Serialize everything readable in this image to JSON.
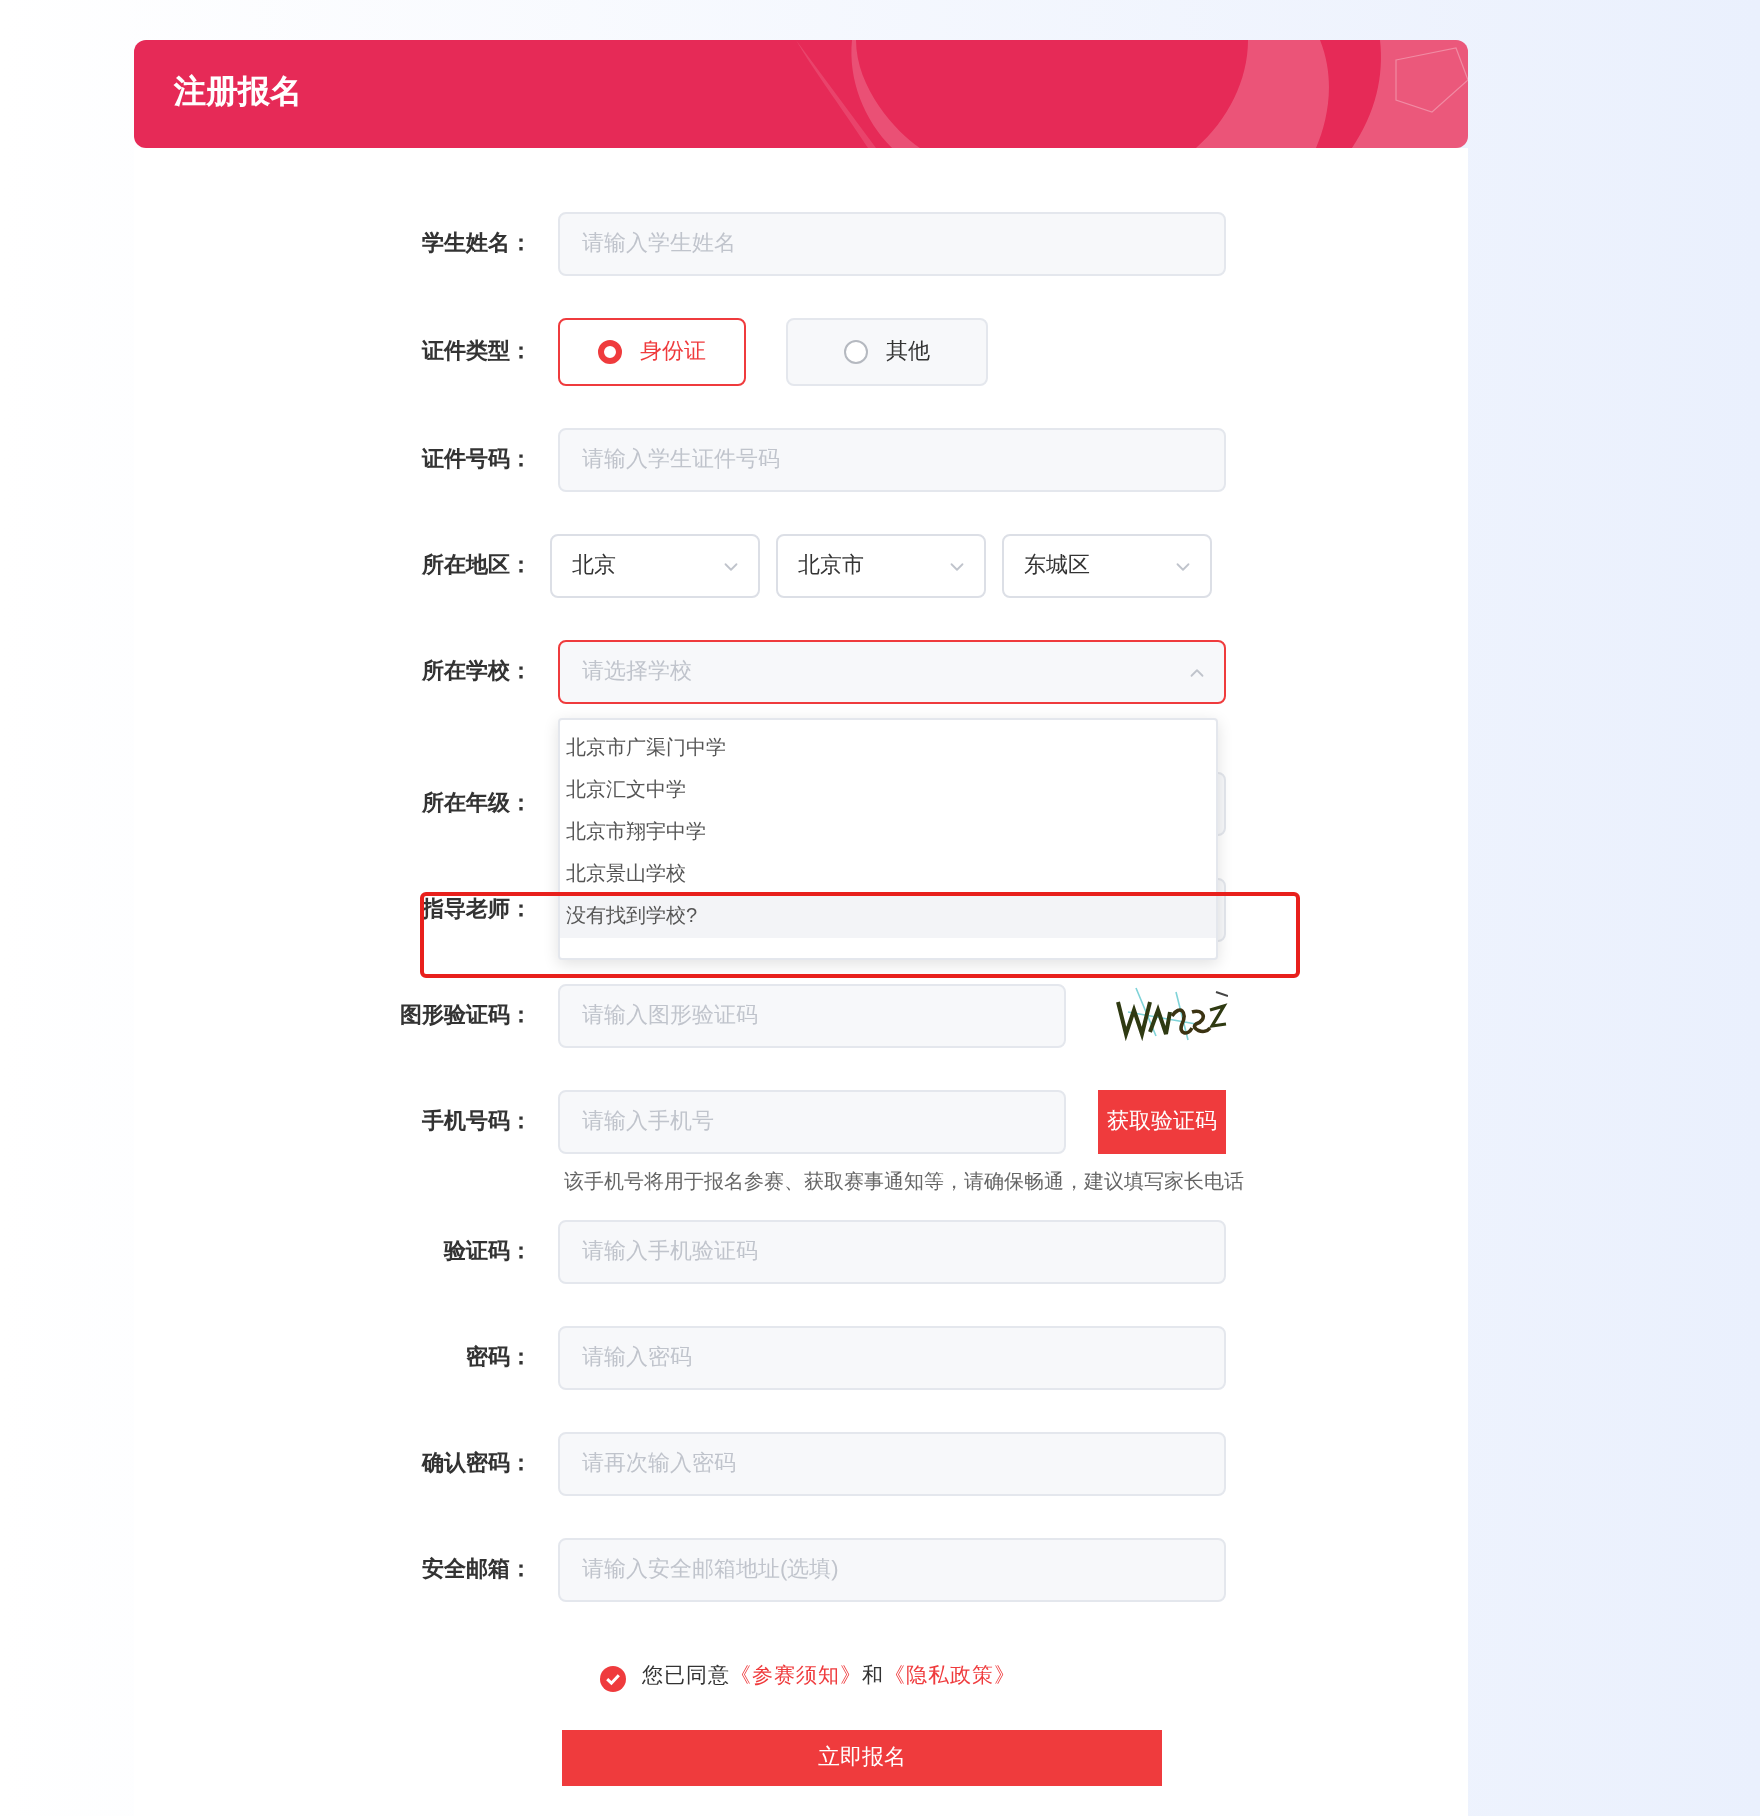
{
  "header": {
    "title": "注册报名"
  },
  "form": {
    "rows": [
      {
        "kind": "input",
        "label": "学生姓名：",
        "placeholder": "请输入学生姓名"
      },
      {
        "kind": "radio",
        "label": "证件类型：",
        "options": [
          {
            "label": "身份证",
            "selected": true
          },
          {
            "label": "其他",
            "selected": false
          }
        ]
      },
      {
        "kind": "input",
        "label": "证件号码：",
        "placeholder": "请输入学生证件号码"
      },
      {
        "kind": "region",
        "label": "所在地区：",
        "selects": [
          {
            "value": "北京"
          },
          {
            "value": "北京市"
          },
          {
            "value": "东城区"
          }
        ]
      },
      {
        "kind": "dropdown",
        "label": "所在学校：",
        "placeholder": "请选择学校",
        "expanded": true,
        "options": [
          {
            "label": "北京市广渠门中学",
            "highlighted": false
          },
          {
            "label": "北京汇文中学",
            "highlighted": false
          },
          {
            "label": "北京市翔宇中学",
            "highlighted": false
          },
          {
            "label": "北京景山学校",
            "highlighted": false
          },
          {
            "label": "没有找到学校?",
            "highlighted": true
          }
        ]
      },
      {
        "kind": "input",
        "label": "所在年级："
      },
      {
        "kind": "input",
        "label": "指导老师："
      },
      {
        "kind": "captcha",
        "label": "图形验证码：",
        "placeholder": "请输入图形验证码"
      },
      {
        "kind": "phone",
        "label": "手机号码：",
        "placeholder": "请输入手机号",
        "button": "获取验证码",
        "hint": "该手机号将用于报名参赛、获取赛事通知等，请确保畅通，建议填写家长电话"
      },
      {
        "kind": "input",
        "label": "验证码：",
        "placeholder": "请输入手机验证码"
      },
      {
        "kind": "input",
        "label": "密码：",
        "placeholder": "请输入密码"
      },
      {
        "kind": "input",
        "label": "确认密码：",
        "placeholder": "请再次输入密码"
      },
      {
        "kind": "input",
        "label": "安全邮箱：",
        "placeholder": "请输入安全邮箱地址(选填)"
      }
    ]
  },
  "agreement": {
    "checked": true,
    "parts": [
      {
        "kind": "text",
        "text": "您已同意"
      },
      {
        "kind": "link",
        "text": "《参赛须知》"
      },
      {
        "kind": "text",
        "text": "和"
      },
      {
        "kind": "link",
        "text": "《隐私政策》"
      }
    ]
  },
  "submit": {
    "label": "立即报名"
  }
}
